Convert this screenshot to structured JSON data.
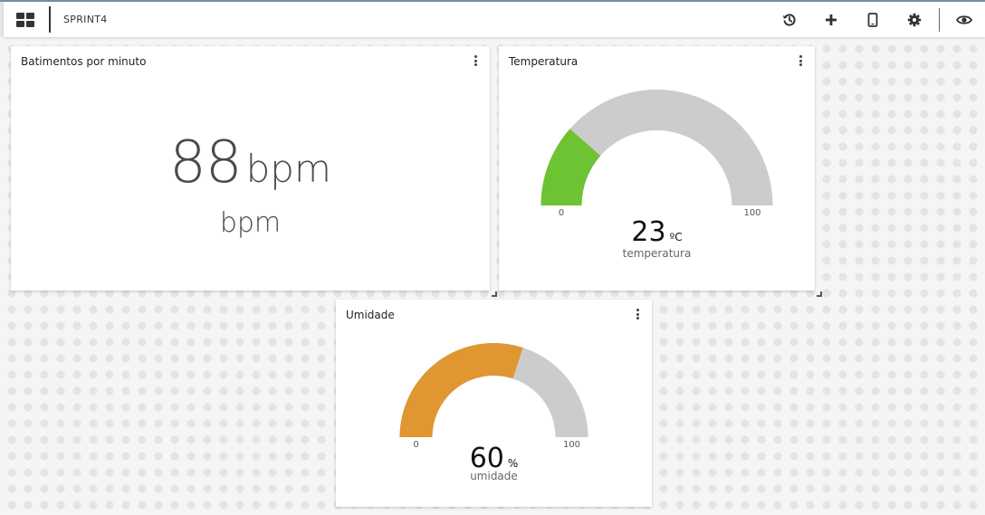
{
  "toolbar": {
    "title": "SPRINT4",
    "icons": [
      "dashboard-grid-icon",
      "history-icon",
      "plus-icon",
      "mobile-icon",
      "gear-icon",
      "eye-icon"
    ]
  },
  "cards": {
    "bpm": {
      "title": "Batimentos por minuto",
      "value": "88",
      "value_unit": "bpm",
      "sub_unit": "bpm"
    },
    "temperatura": {
      "title": "Temperatura",
      "value": 23,
      "value_text": "23",
      "unit": "ºC",
      "label": "temperatura",
      "min": 0,
      "max": 100,
      "min_text": "0",
      "max_text": "100",
      "color": "#6dc332",
      "track_color": "#cccccc"
    },
    "umidade": {
      "title": "Umidade",
      "value": 60,
      "value_text": "60",
      "unit": "%",
      "label": "umidade",
      "min": 0,
      "max": 100,
      "min_text": "0",
      "max_text": "100",
      "color": "#e09732",
      "track_color": "#cccccc"
    }
  }
}
